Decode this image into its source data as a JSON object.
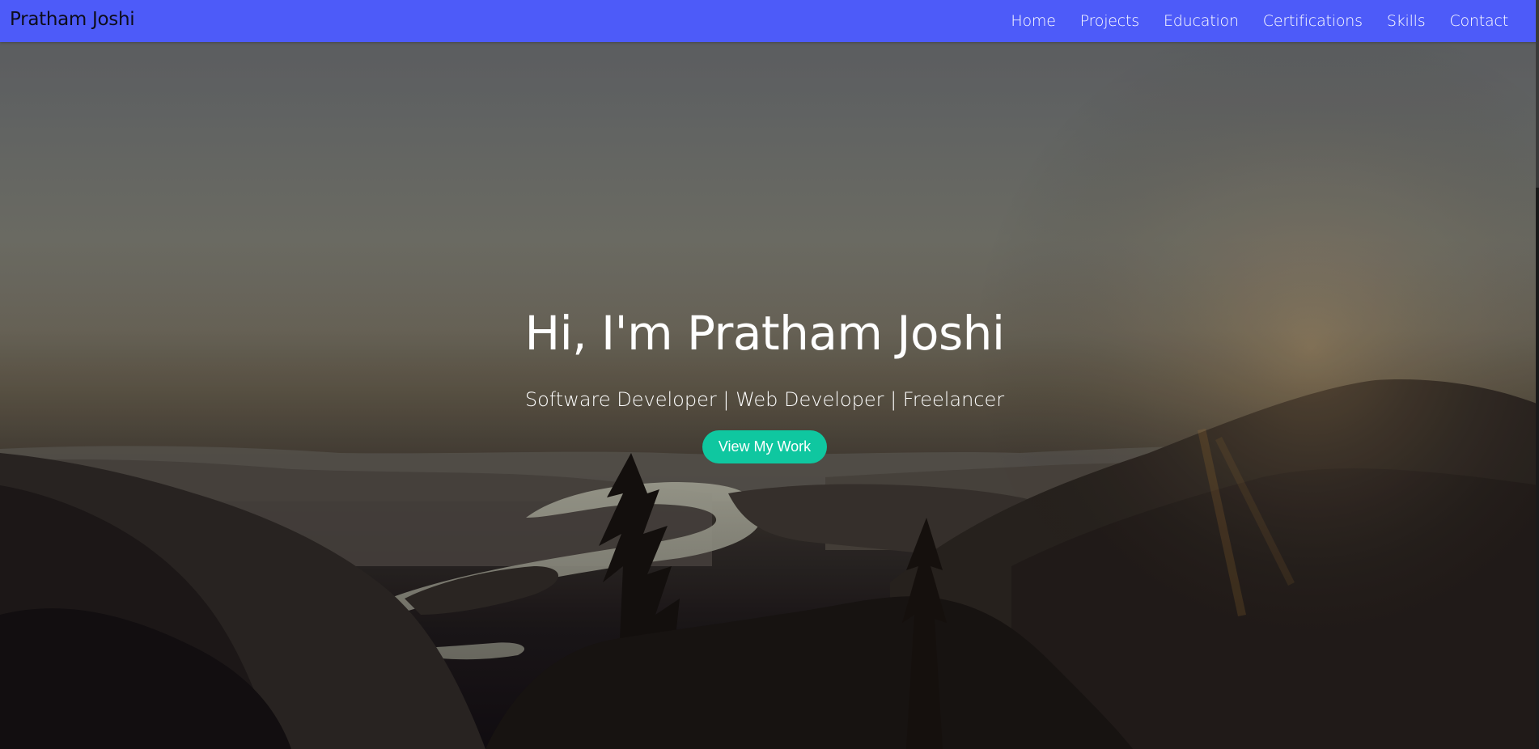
{
  "navbar": {
    "brand": "Pratham Joshi",
    "links": [
      {
        "label": "Home"
      },
      {
        "label": "Projects"
      },
      {
        "label": "Education"
      },
      {
        "label": "Certifications"
      },
      {
        "label": "Skills"
      },
      {
        "label": "Contact"
      }
    ],
    "background_color": "#4d5bf9"
  },
  "hero": {
    "title": "Hi, I'm Pratham Joshi",
    "subtitle": "Software Developer | Web Developer | Freelancer",
    "cta_label": "View My Work",
    "cta_color": "#0fc7a0",
    "background_image": "mountain-river-sunset-landscape"
  }
}
